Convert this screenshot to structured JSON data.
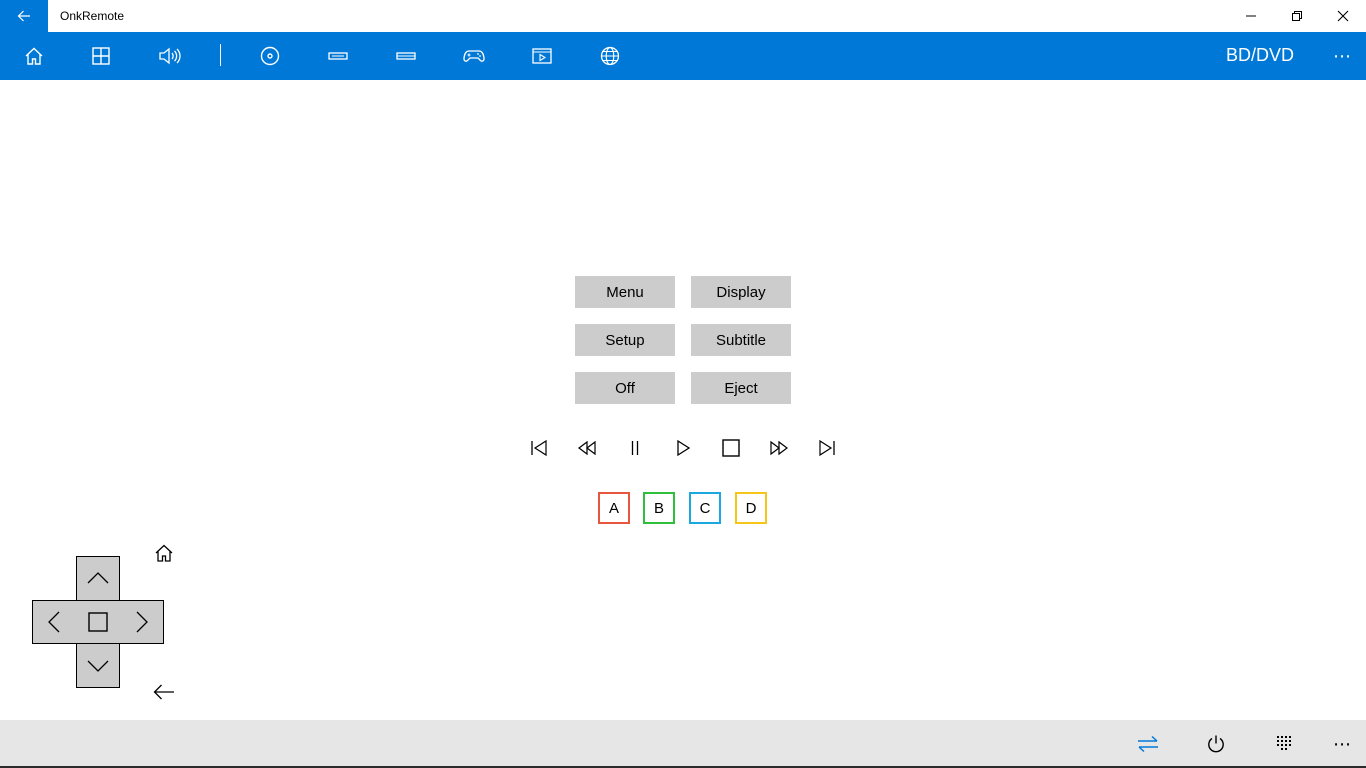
{
  "window": {
    "title": "OnkRemote",
    "accent": "#0078d7"
  },
  "nav": {
    "icons": [
      "home-icon",
      "grid-icon",
      "volume-icon",
      "disc-icon",
      "tuner-icon",
      "device-icon",
      "gamepad-icon",
      "video-icon",
      "globe-icon"
    ],
    "current_source": "BD/DVD",
    "more": "⋯"
  },
  "commands": {
    "menu": "Menu",
    "display": "Display",
    "setup": "Setup",
    "subtitle": "Subtitle",
    "off": "Off",
    "eject": "Eject"
  },
  "playback": [
    "previous-icon",
    "rewind-icon",
    "pause-icon",
    "play-icon",
    "stop-icon",
    "fast-forward-icon",
    "next-icon"
  ],
  "color_keys": [
    {
      "label": "A",
      "color": "#e8553e"
    },
    {
      "label": "B",
      "color": "#2fbf3a"
    },
    {
      "label": "C",
      "color": "#1aa8e0"
    },
    {
      "label": "D",
      "color": "#f5c518"
    }
  ],
  "bottom": {
    "more": "⋯",
    "icons": [
      "switch-icon",
      "power-icon",
      "keypad-icon"
    ],
    "switch_color": "#0078d7"
  }
}
